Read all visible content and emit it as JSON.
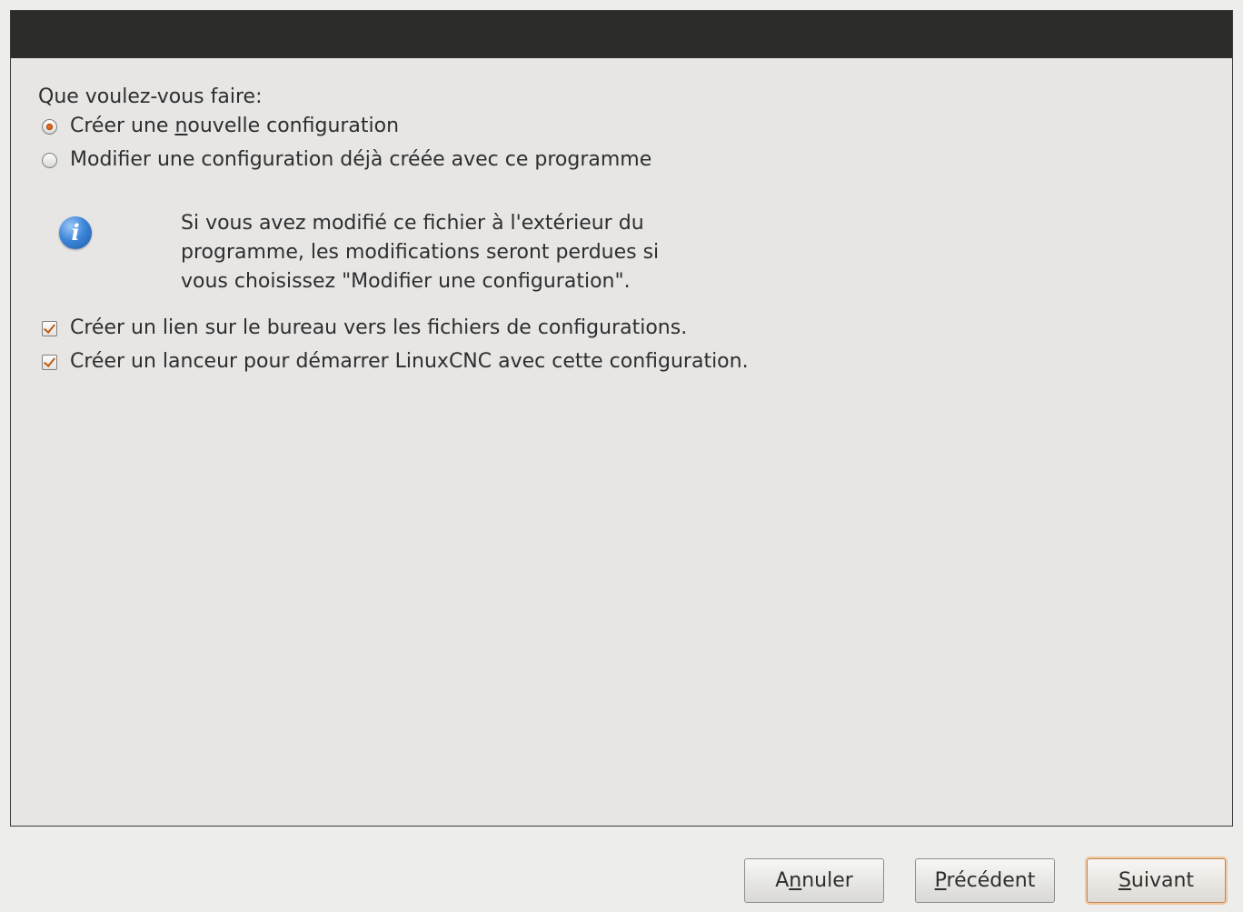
{
  "dialog": {
    "question": "Que voulez-vous faire:",
    "options": [
      {
        "prefix": "Créer une ",
        "mnemonic": "n",
        "suffix": "ouvelle configuration",
        "selected": true
      },
      {
        "label": "Modifier une configuration déjà créée avec ce programme",
        "selected": false
      }
    ],
    "info": {
      "icon": "info-icon",
      "text": "Si vous avez modifié ce fichier à l'extérieur du\nprogramme, les modifications seront perdues si\nvous choisissez \"Modifier une configuration\"."
    },
    "checkboxes": [
      {
        "label": "Créer un lien sur le bureau vers les fichiers de configurations.",
        "checked": true
      },
      {
        "label": "Créer un lanceur pour démarrer LinuxCNC avec cette configuration.",
        "checked": true
      }
    ]
  },
  "buttons": {
    "cancel": {
      "prefix": "A",
      "mnemonic": "n",
      "suffix": "nuler"
    },
    "previous": {
      "prefix": "",
      "mnemonic": "P",
      "suffix": "récédent"
    },
    "next": {
      "prefix": "",
      "mnemonic": "S",
      "suffix": "uivant"
    }
  },
  "colors": {
    "header": "#2c2c2b",
    "accent": "#e06c1c",
    "background": "#e7e6e5"
  }
}
